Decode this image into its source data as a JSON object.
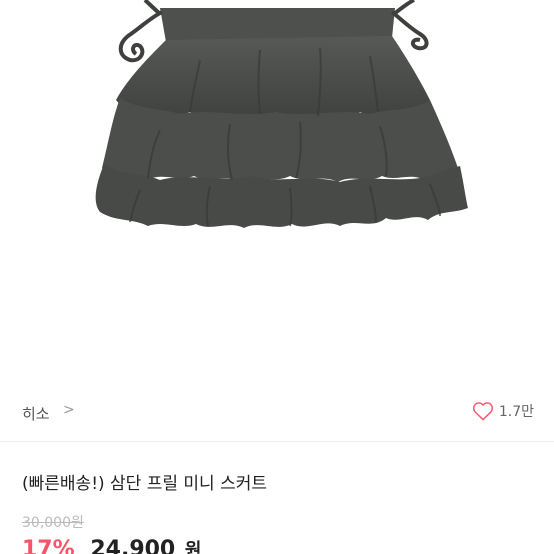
{
  "product": {
    "image_alt": "skirt-photo",
    "title": "(빠른배송!) 삼단 프릴 미니 스커트"
  },
  "seller": {
    "name": "히소",
    "chevron": ">"
  },
  "likes": {
    "count": "1.7만",
    "icon": "heart-outline-icon"
  },
  "price": {
    "original": "30,000원",
    "discount": "17%",
    "sale": "24,900",
    "currency": "원"
  },
  "colors": {
    "accent": "#f5546a",
    "skirt": "#4a4d4a"
  }
}
